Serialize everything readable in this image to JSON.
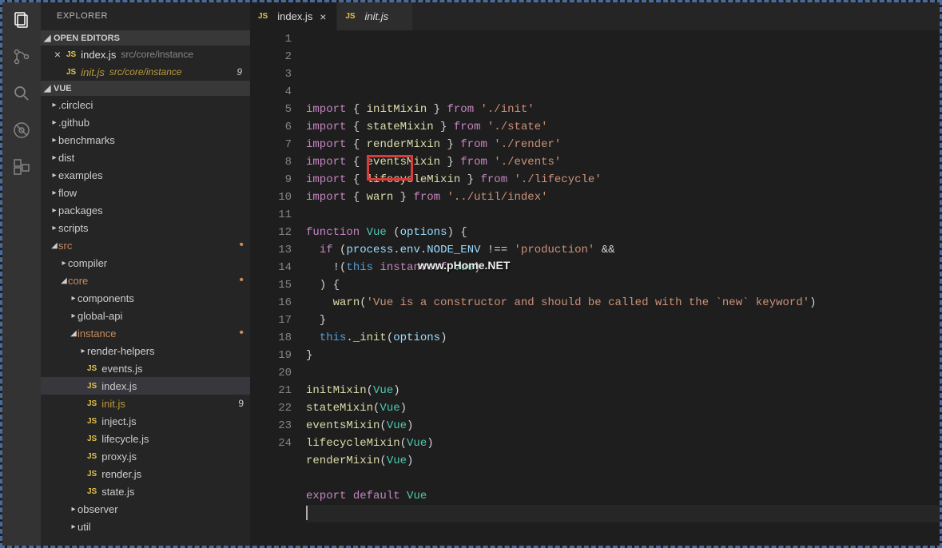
{
  "sidebar": {
    "title": "EXPLORER",
    "sections": {
      "openEditors": "OPEN EDITORS",
      "project": "VUE"
    }
  },
  "openEditors": [
    {
      "icon": "×",
      "name": "index.js",
      "path": "src/core/instance",
      "problem": false,
      "badge": ""
    },
    {
      "icon": "",
      "name": "init.js",
      "path": "src/core/instance",
      "problem": true,
      "badge": "9"
    }
  ],
  "tree": [
    {
      "depth": 0,
      "type": "folder",
      "expanded": false,
      "label": ".circleci"
    },
    {
      "depth": 0,
      "type": "folder",
      "expanded": false,
      "label": ".github"
    },
    {
      "depth": 0,
      "type": "folder",
      "expanded": false,
      "label": "benchmarks"
    },
    {
      "depth": 0,
      "type": "folder",
      "expanded": false,
      "label": "dist"
    },
    {
      "depth": 0,
      "type": "folder",
      "expanded": false,
      "label": "examples"
    },
    {
      "depth": 0,
      "type": "folder",
      "expanded": false,
      "label": "flow"
    },
    {
      "depth": 0,
      "type": "folder",
      "expanded": false,
      "label": "packages"
    },
    {
      "depth": 0,
      "type": "folder",
      "expanded": false,
      "label": "scripts"
    },
    {
      "depth": 0,
      "type": "folder",
      "expanded": true,
      "label": "src",
      "dot": true
    },
    {
      "depth": 1,
      "type": "folder",
      "expanded": false,
      "label": "compiler"
    },
    {
      "depth": 1,
      "type": "folder",
      "expanded": true,
      "label": "core",
      "dot": true
    },
    {
      "depth": 2,
      "type": "folder",
      "expanded": false,
      "label": "components"
    },
    {
      "depth": 2,
      "type": "folder",
      "expanded": false,
      "label": "global-api"
    },
    {
      "depth": 2,
      "type": "folder",
      "expanded": true,
      "label": "instance",
      "dot": true
    },
    {
      "depth": 3,
      "type": "folder",
      "expanded": false,
      "label": "render-helpers"
    },
    {
      "depth": 3,
      "type": "file",
      "label": "events.js"
    },
    {
      "depth": 3,
      "type": "file",
      "label": "index.js",
      "selected": true
    },
    {
      "depth": 3,
      "type": "file",
      "label": "init.js",
      "problem": true,
      "badge": "9"
    },
    {
      "depth": 3,
      "type": "file",
      "label": "inject.js"
    },
    {
      "depth": 3,
      "type": "file",
      "label": "lifecycle.js"
    },
    {
      "depth": 3,
      "type": "file",
      "label": "proxy.js"
    },
    {
      "depth": 3,
      "type": "file",
      "label": "render.js"
    },
    {
      "depth": 3,
      "type": "file",
      "label": "state.js"
    },
    {
      "depth": 2,
      "type": "folder",
      "expanded": false,
      "label": "observer"
    },
    {
      "depth": 2,
      "type": "folder",
      "expanded": false,
      "label": "util"
    }
  ],
  "tabs": [
    {
      "label": "index.js",
      "active": true,
      "italic": false,
      "close": "×"
    },
    {
      "label": "init.js",
      "active": false,
      "italic": true,
      "close": ""
    }
  ],
  "code": {
    "lines": [
      [
        [
          "k",
          "import"
        ],
        [
          "p",
          " { "
        ],
        [
          "fn",
          "initMixin"
        ],
        [
          "p",
          " } "
        ],
        [
          "k",
          "from"
        ],
        [
          "p",
          " "
        ],
        [
          "s",
          "'./init'"
        ]
      ],
      [
        [
          "k",
          "import"
        ],
        [
          "p",
          " { "
        ],
        [
          "fn",
          "stateMixin"
        ],
        [
          "p",
          " } "
        ],
        [
          "k",
          "from"
        ],
        [
          "p",
          " "
        ],
        [
          "s",
          "'./state'"
        ]
      ],
      [
        [
          "k",
          "import"
        ],
        [
          "p",
          " { "
        ],
        [
          "fn",
          "renderMixin"
        ],
        [
          "p",
          " } "
        ],
        [
          "k",
          "from"
        ],
        [
          "p",
          " "
        ],
        [
          "s",
          "'./render'"
        ]
      ],
      [
        [
          "k",
          "import"
        ],
        [
          "p",
          " { "
        ],
        [
          "fn",
          "eventsMixin"
        ],
        [
          "p",
          " } "
        ],
        [
          "k",
          "from"
        ],
        [
          "p",
          " "
        ],
        [
          "s",
          "'./events'"
        ]
      ],
      [
        [
          "k",
          "import"
        ],
        [
          "p",
          " { "
        ],
        [
          "fn",
          "lifecycleMixin"
        ],
        [
          "p",
          " } "
        ],
        [
          "k",
          "from"
        ],
        [
          "p",
          " "
        ],
        [
          "s",
          "'./lifecycle'"
        ]
      ],
      [
        [
          "k",
          "import"
        ],
        [
          "p",
          " { "
        ],
        [
          "fn",
          "warn"
        ],
        [
          "p",
          " } "
        ],
        [
          "k",
          "from"
        ],
        [
          "p",
          " "
        ],
        [
          "s",
          "'../util/index'"
        ]
      ],
      [],
      [
        [
          "k",
          "function"
        ],
        [
          "p",
          " "
        ],
        [
          "cls",
          "Vue"
        ],
        [
          "p",
          " ("
        ],
        [
          "id",
          "options"
        ],
        [
          "p",
          ") {"
        ]
      ],
      [
        [
          "p",
          "  "
        ],
        [
          "k",
          "if"
        ],
        [
          "p",
          " ("
        ],
        [
          "id",
          "process"
        ],
        [
          "p",
          "."
        ],
        [
          "id",
          "env"
        ],
        [
          "p",
          "."
        ],
        [
          "id",
          "NODE_ENV"
        ],
        [
          "p",
          " !== "
        ],
        [
          "s",
          "'production'"
        ],
        [
          "p",
          " &&"
        ]
      ],
      [
        [
          "p",
          "    !("
        ],
        [
          "this",
          "this"
        ],
        [
          "p",
          " "
        ],
        [
          "k",
          "instanceof"
        ],
        [
          "p",
          " "
        ],
        [
          "cls",
          "Vue"
        ],
        [
          "p",
          ")"
        ]
      ],
      [
        [
          "p",
          "  ) {"
        ]
      ],
      [
        [
          "p",
          "    "
        ],
        [
          "fn",
          "warn"
        ],
        [
          "p",
          "("
        ],
        [
          "s",
          "'Vue is a constructor and should be called with the `new` keyword'"
        ],
        [
          "p",
          ")"
        ]
      ],
      [
        [
          "p",
          "  }"
        ]
      ],
      [
        [
          "p",
          "  "
        ],
        [
          "this",
          "this"
        ],
        [
          "p",
          "."
        ],
        [
          "fn",
          "_init"
        ],
        [
          "p",
          "("
        ],
        [
          "id",
          "options"
        ],
        [
          "p",
          ")"
        ]
      ],
      [
        [
          "p",
          "}"
        ]
      ],
      [],
      [
        [
          "fn",
          "initMixin"
        ],
        [
          "p",
          "("
        ],
        [
          "cls",
          "Vue"
        ],
        [
          "p",
          ")"
        ]
      ],
      [
        [
          "fn",
          "stateMixin"
        ],
        [
          "p",
          "("
        ],
        [
          "cls",
          "Vue"
        ],
        [
          "p",
          ")"
        ]
      ],
      [
        [
          "fn",
          "eventsMixin"
        ],
        [
          "p",
          "("
        ],
        [
          "cls",
          "Vue"
        ],
        [
          "p",
          ")"
        ]
      ],
      [
        [
          "fn",
          "lifecycleMixin"
        ],
        [
          "p",
          "("
        ],
        [
          "cls",
          "Vue"
        ],
        [
          "p",
          ")"
        ]
      ],
      [
        [
          "fn",
          "renderMixin"
        ],
        [
          "p",
          "("
        ],
        [
          "cls",
          "Vue"
        ],
        [
          "p",
          ")"
        ]
      ],
      [],
      [
        [
          "k",
          "export"
        ],
        [
          "p",
          " "
        ],
        [
          "k",
          "default"
        ],
        [
          "p",
          " "
        ],
        [
          "cls",
          "Vue"
        ]
      ],
      []
    ]
  },
  "watermark": "www.pHome.NET"
}
